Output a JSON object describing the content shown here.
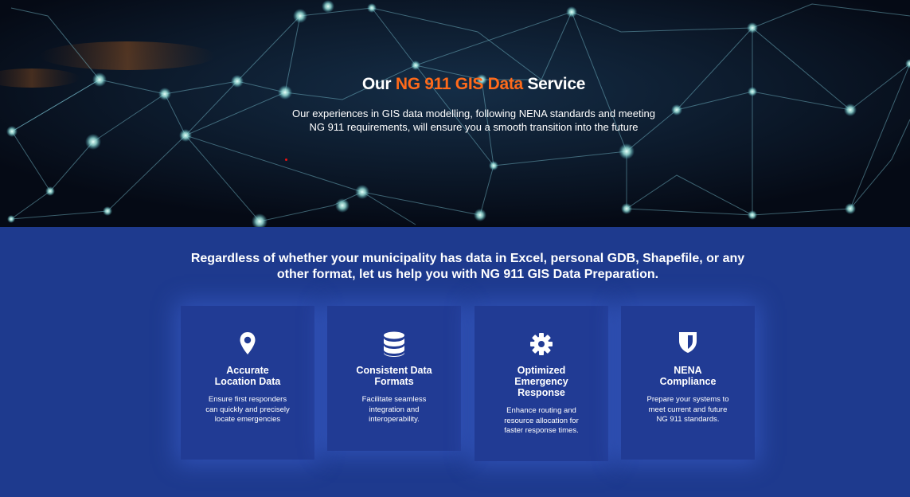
{
  "hero": {
    "title_prefix": "Our ",
    "title_accent": "NG 911 GIS Data",
    "title_suffix": " Service",
    "subtitle": "Our experiences in GIS data modelling, following NENA standards and meeting NG 911 requirements, will ensure you a smooth transition into the future"
  },
  "intro": {
    "text": "Regardless of whether your municipality has data in Excel, personal GDB, Shapefile, or any other format, let us help you with NG 911 GIS Data Preparation."
  },
  "features": [
    {
      "icon": "location-pin-icon",
      "title": "Accurate Location Data",
      "description": "Ensure first responders can quickly and precisely locate emergencies"
    },
    {
      "icon": "database-icon",
      "title": "Consistent Data Formats",
      "description": "Facilitate seamless integration and interoperability."
    },
    {
      "icon": "gear-icon",
      "title": "Optimized Emergency Response",
      "description": "Enhance routing and resource allocation for faster response times."
    },
    {
      "icon": "shield-icon",
      "title": "NENA Compliance",
      "description": "Prepare your systems to meet current and future NG 911 standards."
    }
  ],
  "colors": {
    "accent": "#ff6a1a",
    "band_background": "#1e3a8e",
    "card_background": "#213b94",
    "hero_background": "#07101f"
  }
}
